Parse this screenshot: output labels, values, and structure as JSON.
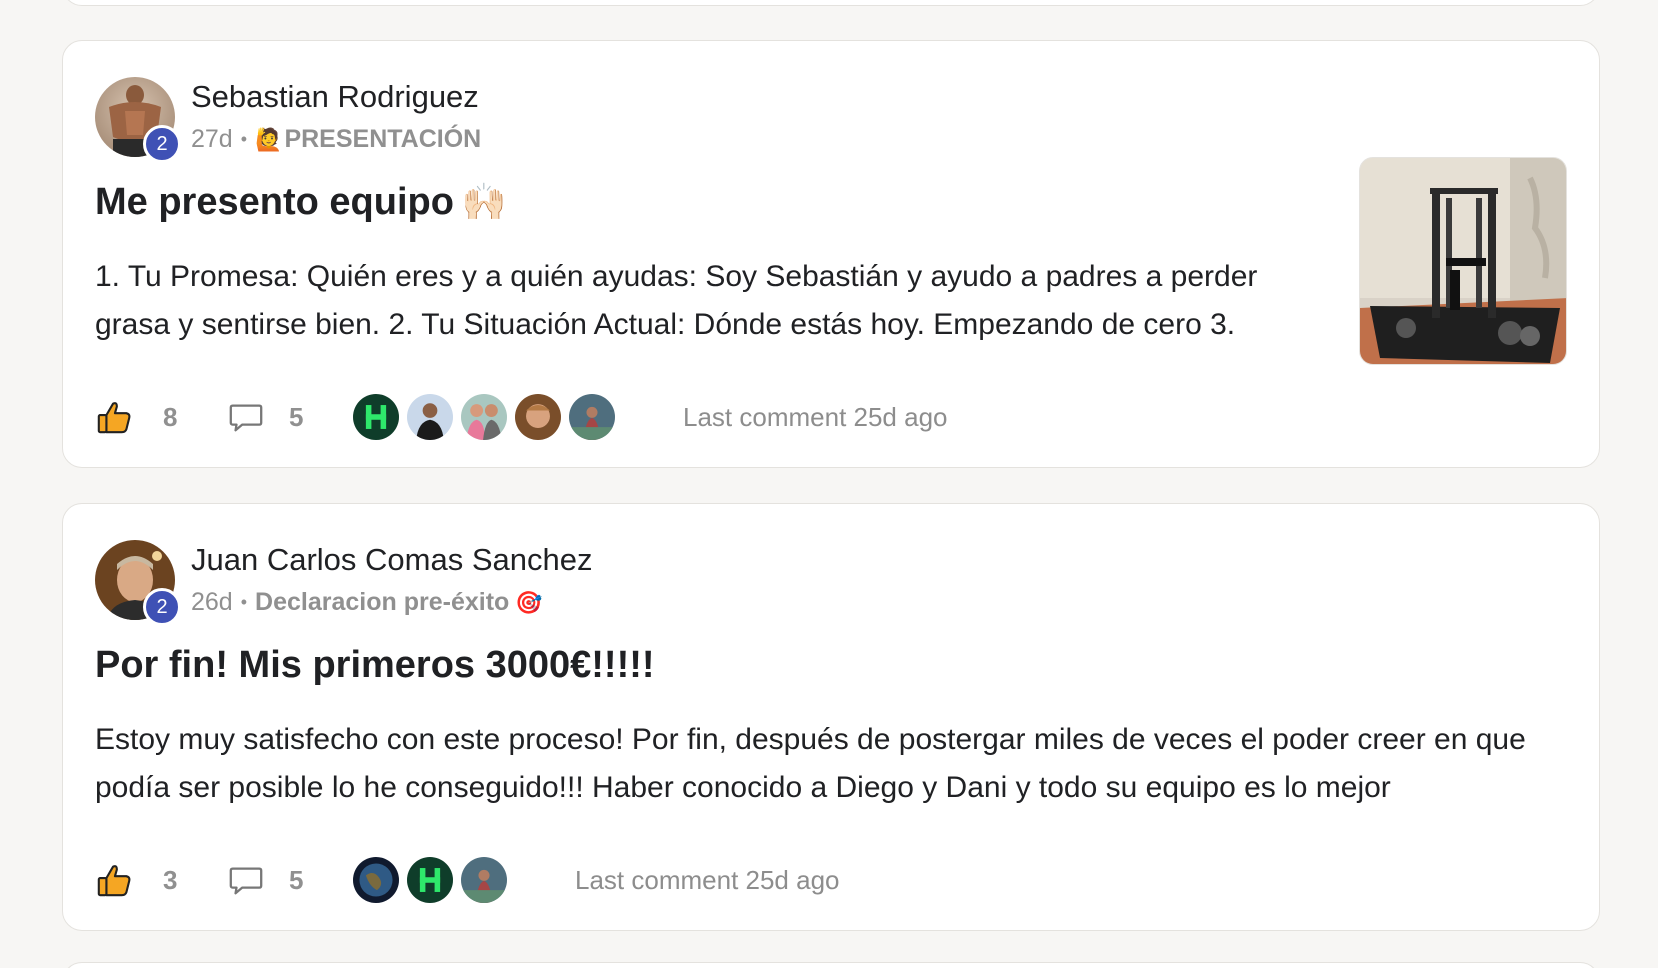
{
  "posts": [
    {
      "author": "Sebastian Rodriguez",
      "level": "2",
      "age": "27d",
      "category_emoji": "🙋",
      "category": "PRESENTACIÓN",
      "category_suffix_emoji": "",
      "title": "Me presento equipo",
      "title_emoji": "🙌🏻",
      "body": "1. Tu Promesa: Quién eres y a quién ayudas: Soy Sebastián y ayudo a padres a perder grasa y sentirse bien. 2. Tu Situación Actual: Dónde estás hoy. Empezando de cero 3.",
      "likes": "8",
      "comments": "5",
      "last_comment": "Last comment 25d ago",
      "has_thumbnail": true,
      "commenter_count": 5
    },
    {
      "author": "Juan Carlos Comas Sanchez",
      "level": "2",
      "age": "26d",
      "category_emoji": "",
      "category": "Declaracion pre-éxito",
      "category_suffix_emoji": "🎯",
      "title": "Por fin! Mis primeros 3000€!!!!!",
      "title_emoji": "",
      "body": "Estoy muy satisfecho con este proceso! Por fin, después de postergar miles de veces el poder creer en que podía ser posible lo he conseguido!!! Haber conocido a Diego y Dani y todo su equipo es lo mejor",
      "likes": "3",
      "comments": "5",
      "last_comment": "Last comment 25d ago",
      "has_thumbnail": false,
      "commenter_count": 3
    }
  ],
  "icons": {
    "like": "thumbs-up-icon",
    "comment": "comment-bubble-icon",
    "like_color": "#f5a623",
    "badge_color": "#3f51b5"
  }
}
